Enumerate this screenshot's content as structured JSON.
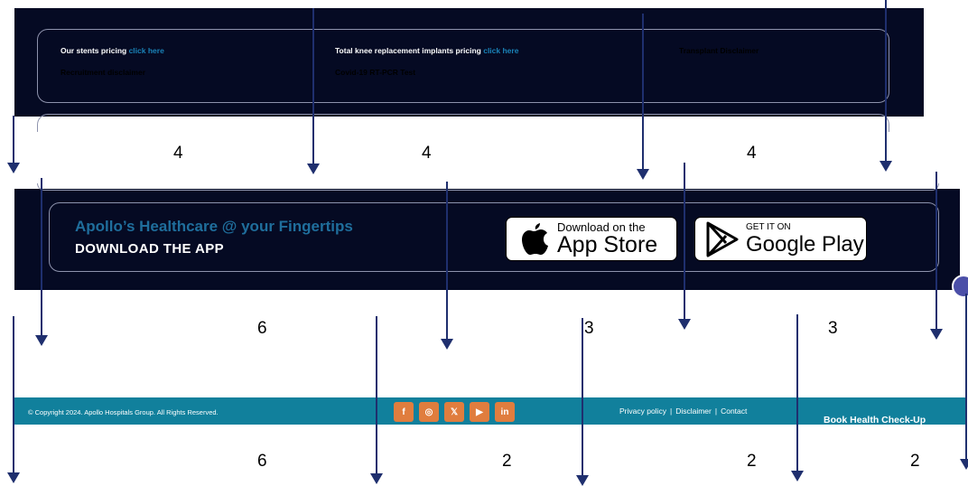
{
  "quick_links": {
    "stents_prefix": "Our stents pricing ",
    "stents_link": "click here",
    "knee_prefix": "Total knee replacement implants pricing ",
    "knee_link": "click here",
    "transplant": "Transplant Disclaimer",
    "recruitment": "Recruitment disclaimer",
    "covid": "Covid-19 RT-PCR Test"
  },
  "app_promo": {
    "tagline": "Apollo’s Healthcare @ your Fingertips",
    "title": "DOWNLOAD THE APP",
    "app_store_small": "Download on the",
    "app_store_big": "App Store",
    "google_small": "GET IT ON",
    "google_big": "Google Play"
  },
  "footer": {
    "copyright": "© Copyright 2024. Apollo Hospitals Group. All Rights Reserved.",
    "social": [
      "f",
      "◎",
      "𝕏",
      "▶",
      "in"
    ],
    "links": [
      "Privacy policy",
      "Disclaimer",
      "Contact"
    ],
    "book_cta": "Book Health Check-Up"
  },
  "annotations": {
    "row1": [
      "4",
      "4",
      "4"
    ],
    "row2": [
      "6",
      "3",
      "3"
    ],
    "row3": [
      "6",
      "2",
      "2",
      "2"
    ]
  },
  "colors": {
    "dark_bg": "#050a23",
    "footer_bg": "#11809c",
    "social_bg": "#e07d3e",
    "link_blue": "#1a83b8",
    "arrow": "#1f2f6e"
  },
  "icons": {
    "apple": "apple-logo-icon",
    "google_play": "google-play-icon",
    "chat": "chat-bubble-icon"
  }
}
